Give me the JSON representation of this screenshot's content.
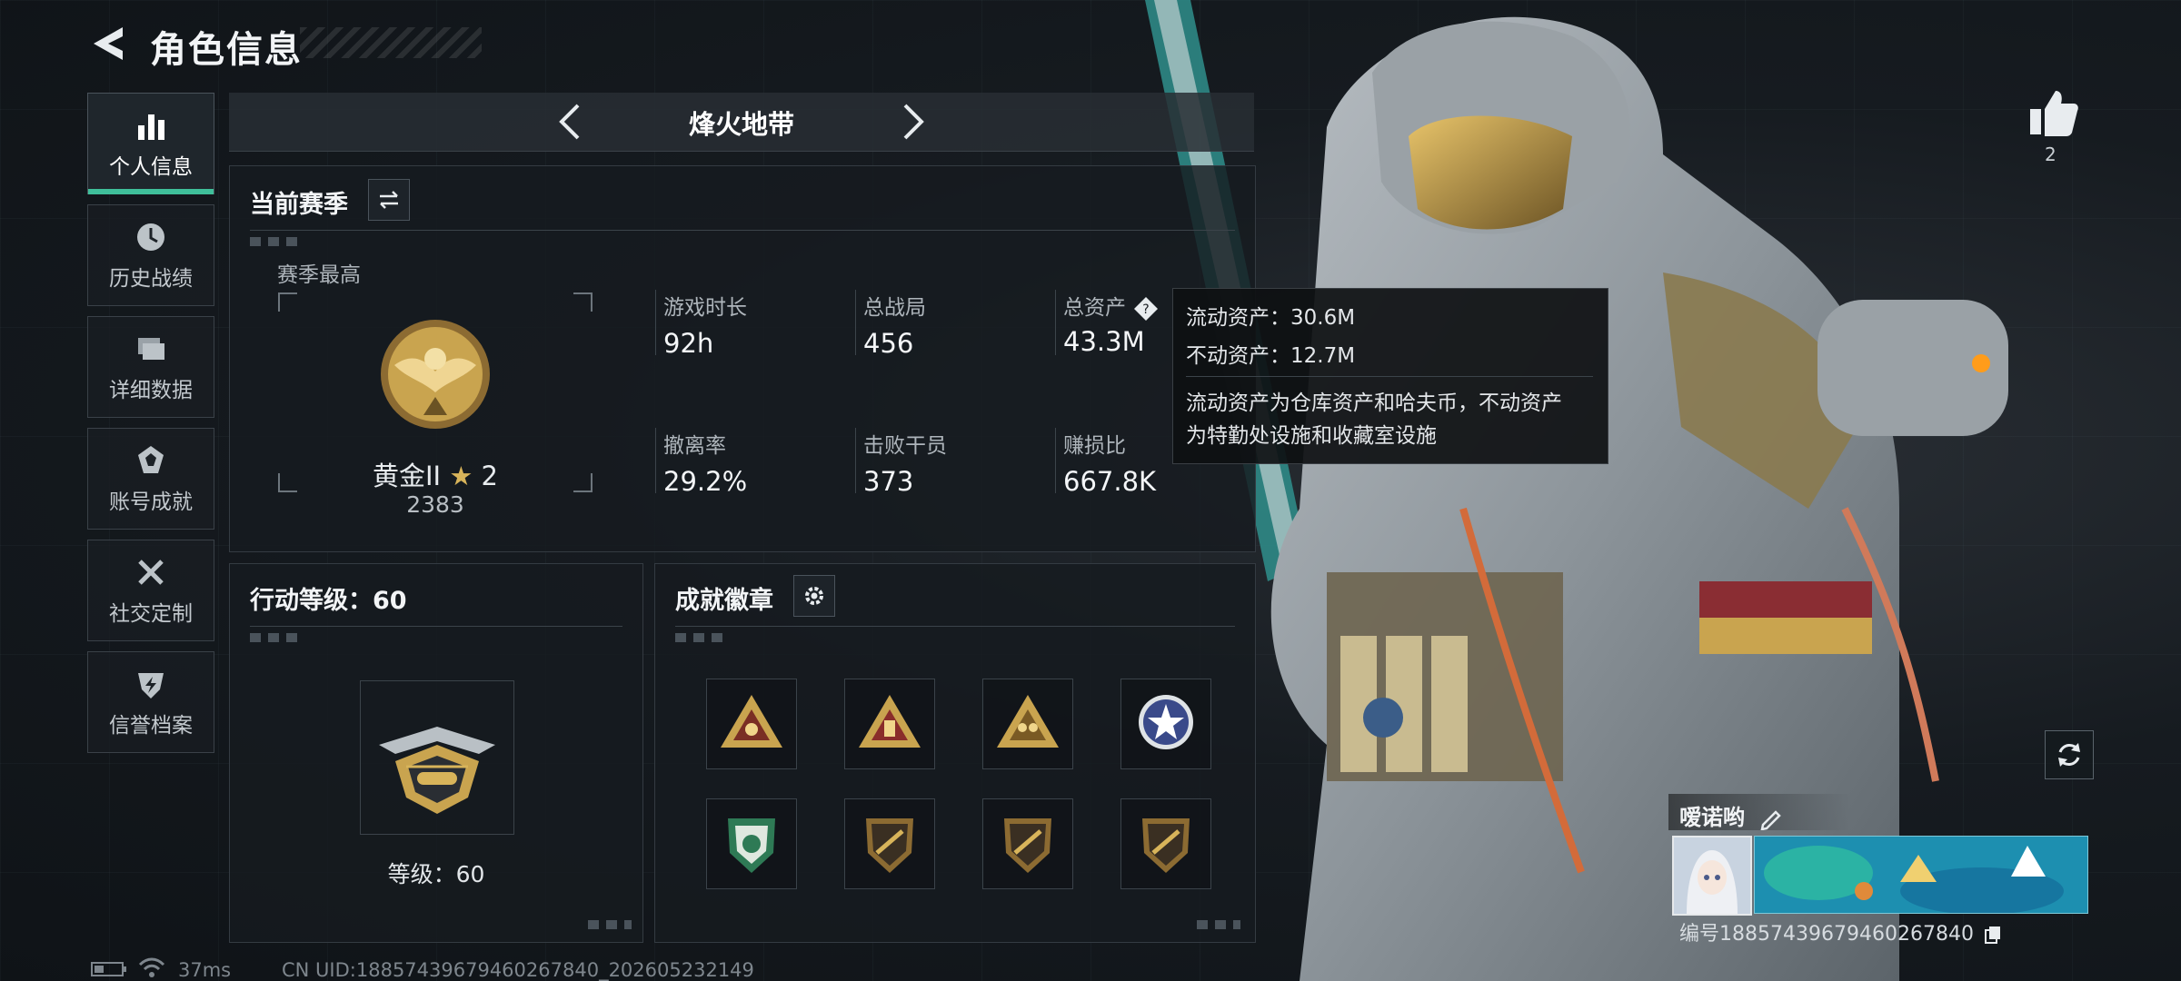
{
  "header": {
    "title": "角色信息"
  },
  "nav": {
    "items": [
      {
        "label": "个人信息",
        "icon": "bar-chart-icon",
        "active": true
      },
      {
        "label": "历史战绩",
        "icon": "history-clock-icon",
        "active": false
      },
      {
        "label": "详细数据",
        "icon": "folders-icon",
        "active": false
      },
      {
        "label": "账号成就",
        "icon": "achievement-icon",
        "active": false
      },
      {
        "label": "社交定制",
        "icon": "tools-icon",
        "active": false
      },
      {
        "label": "信誉档案",
        "icon": "shield-bolt-icon",
        "active": false
      }
    ]
  },
  "mode": {
    "title": "烽火地带"
  },
  "season": {
    "title": "当前赛季",
    "best_label": "赛季最高",
    "rank_name": "黄金II",
    "rank_stars": "2",
    "rank_points": "2383",
    "stats": [
      {
        "label": "游戏时长",
        "value": "92h"
      },
      {
        "label": "总战局",
        "value": "456"
      },
      {
        "label": "总资产",
        "value": "43.3M"
      },
      {
        "label": "撤离率",
        "value": "29.2%"
      },
      {
        "label": "击败干员",
        "value": "373"
      },
      {
        "label": "赚损比",
        "value": "667.8K"
      }
    ]
  },
  "tooltip": {
    "line1": "流动资产：30.6M",
    "line2": "不动资产：12.7M",
    "desc1": "流动资产为仓库资产和哈夫币，不动资产",
    "desc2": "为特勤处设施和收藏室设施"
  },
  "level": {
    "title": "行动等级：60",
    "level_text": "等级：60"
  },
  "achievements": {
    "title": "成就徽章",
    "badges": [
      "triangle-badge-icon",
      "rock-hand-badge-icon",
      "crowd-badge-icon",
      "star-badge-icon",
      "green-shield-badge-icon",
      "rifle-shield-badge-icon",
      "rifle-shield-badge-icon",
      "rifle-shield-badge-icon"
    ]
  },
  "footer": {
    "ping": "37ms",
    "uid": "CN UID:18857439679460267840_202605232149"
  },
  "profile": {
    "likes": "2",
    "player_name": "嗳诺哟",
    "player_id": "编号18857439679460267840"
  },
  "colors": {
    "accent": "#3fbf9a",
    "gold": "#c9a44f"
  }
}
